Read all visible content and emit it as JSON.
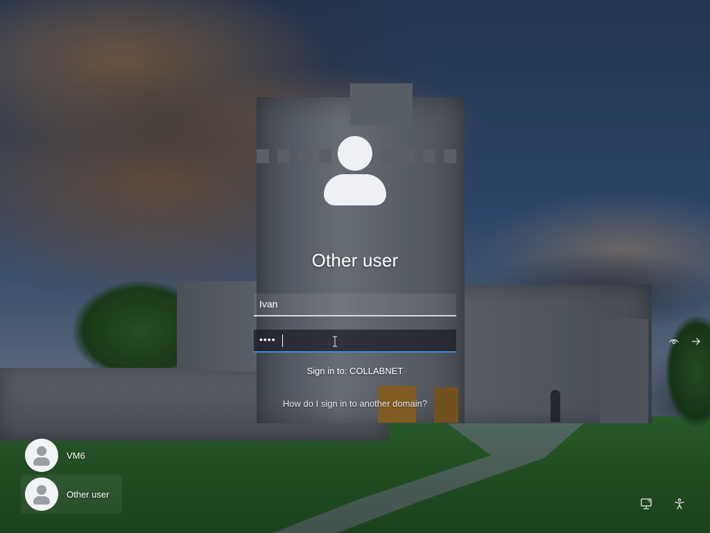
{
  "login": {
    "user_title": "Other user",
    "username_value": "Ivan",
    "password_mask": "••••",
    "signin_to": "Sign in to: COLLABNET",
    "other_domain_link": "How do I sign in to another domain?"
  },
  "users": [
    {
      "name": "VM6",
      "selected": false
    },
    {
      "name": "Other user",
      "selected": true
    }
  ],
  "icons": {
    "reveal": "eye-icon",
    "submit": "arrow-right-icon",
    "network": "network-icon",
    "accessibility": "accessibility-icon"
  },
  "colors": {
    "focus_underline": "#3b8ae0"
  }
}
